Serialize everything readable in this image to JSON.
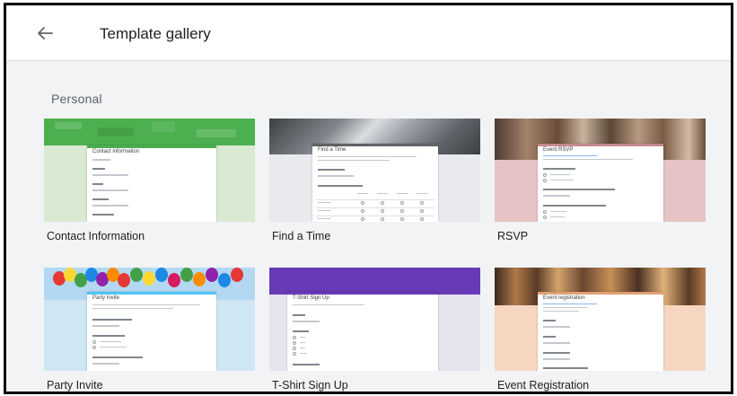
{
  "header": {
    "title": "Template gallery",
    "back_icon": "arrow-left-icon"
  },
  "section_title": "Personal",
  "templates": [
    {
      "label": "Contact Information",
      "form_title": "Contact information",
      "bg": "#d9ead3",
      "band": "#4caf50"
    },
    {
      "label": "Find a Time",
      "form_title": "Find a Time",
      "bg": "#e8eaed",
      "band": "#5f6368"
    },
    {
      "label": "RSVP",
      "form_title": "Event RSVP",
      "bg": "#e6c4c6",
      "band": "#8a6a5a"
    },
    {
      "label": "Party Invite",
      "form_title": "Party Invite",
      "bg": "#cfe6f5",
      "band": "#8ec3e6"
    },
    {
      "label": "T-Shirt Sign Up",
      "form_title": "T-Shirt Sign Up",
      "bg": "#e6e4ee",
      "band": "#673ab7"
    },
    {
      "label": "Event Registration",
      "form_title": "Event registration",
      "bg": "#f6d6c0",
      "band": "#8a5a3a"
    }
  ]
}
